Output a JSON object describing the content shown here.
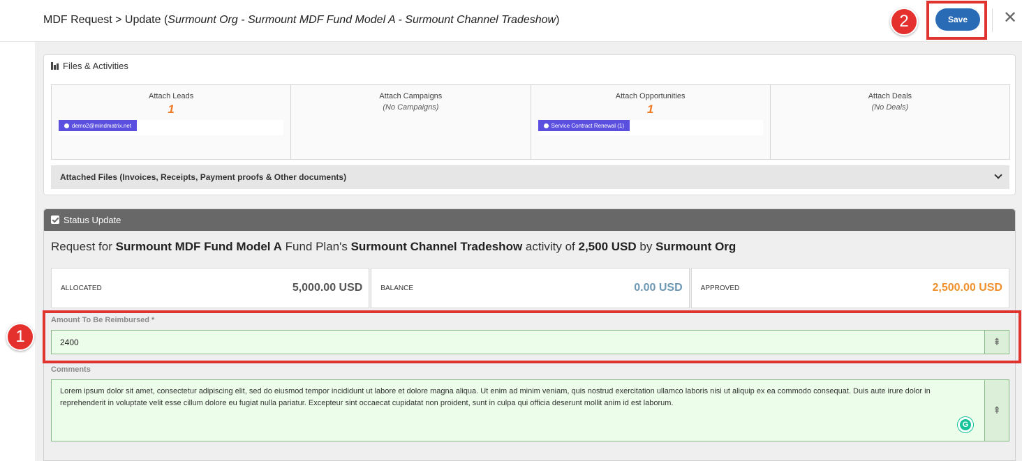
{
  "header": {
    "title_prefix": "MDF Request > Update (",
    "title_italic": "Surmount Org - Surmount MDF Fund Model A - Surmount Channel Tradeshow",
    "title_suffix": ")",
    "save_label": "Save",
    "close_glyph": "✕"
  },
  "badges": {
    "one": "1",
    "two": "2"
  },
  "files_panel": {
    "title": "Files & Activities",
    "cells": [
      {
        "label": "Attach Leads",
        "count": "1",
        "chip": "demo2@mindmatrix.net"
      },
      {
        "label": "Attach Campaigns",
        "empty": "(No Campaigns)"
      },
      {
        "label": "Attach Opportunities",
        "count": "1",
        "chip": "Service Contract Renewal (1)"
      },
      {
        "label": "Attach Deals",
        "empty": "(No Deals)"
      }
    ],
    "attached_files_label": "Attached Files (Invoices, Receipts, Payment proofs & Other documents)"
  },
  "status_panel": {
    "title": "Status Update",
    "request": {
      "p1": "Request for ",
      "fund": "Surmount MDF Fund Model A",
      "p2": " Fund Plan's ",
      "activity": "Surmount Channel Tradeshow",
      "p3": " activity of ",
      "amount": "2,500 USD",
      "p4": " by ",
      "org": "Surmount Org"
    },
    "stats": [
      {
        "label": "ALLOCATED",
        "value": "5,000.00 USD",
        "color": "#555555"
      },
      {
        "label": "BALANCE",
        "value": "0.00 USD",
        "color": "#6d98b4"
      },
      {
        "label": "APPROVED",
        "value": "2,500.00 USD",
        "color": "#f0902c"
      }
    ],
    "amount_label": "Amount To Be Reimbursed  *",
    "amount_value": "2400",
    "comments_label": "Comments",
    "comments_text": "Lorem ipsum dolor sit amet, consectetur adipiscing elit, sed do eiusmod tempor incididunt ut labore et dolore magna aliqua. Ut enim ad minim veniam, quis nostrud exercitation ullamco laboris nisi ut aliquip ex ea commodo consequat. Duis aute irure dolor in reprehenderit in voluptate velit esse cillum dolore eu fugiat nulla pariatur. Excepteur sint occaecat cupidatat non proident, sunt in culpa qui officia deserunt mollit anim id est laborum.",
    "grammarly_glyph": "G",
    "expand_glyph": "⇞"
  }
}
